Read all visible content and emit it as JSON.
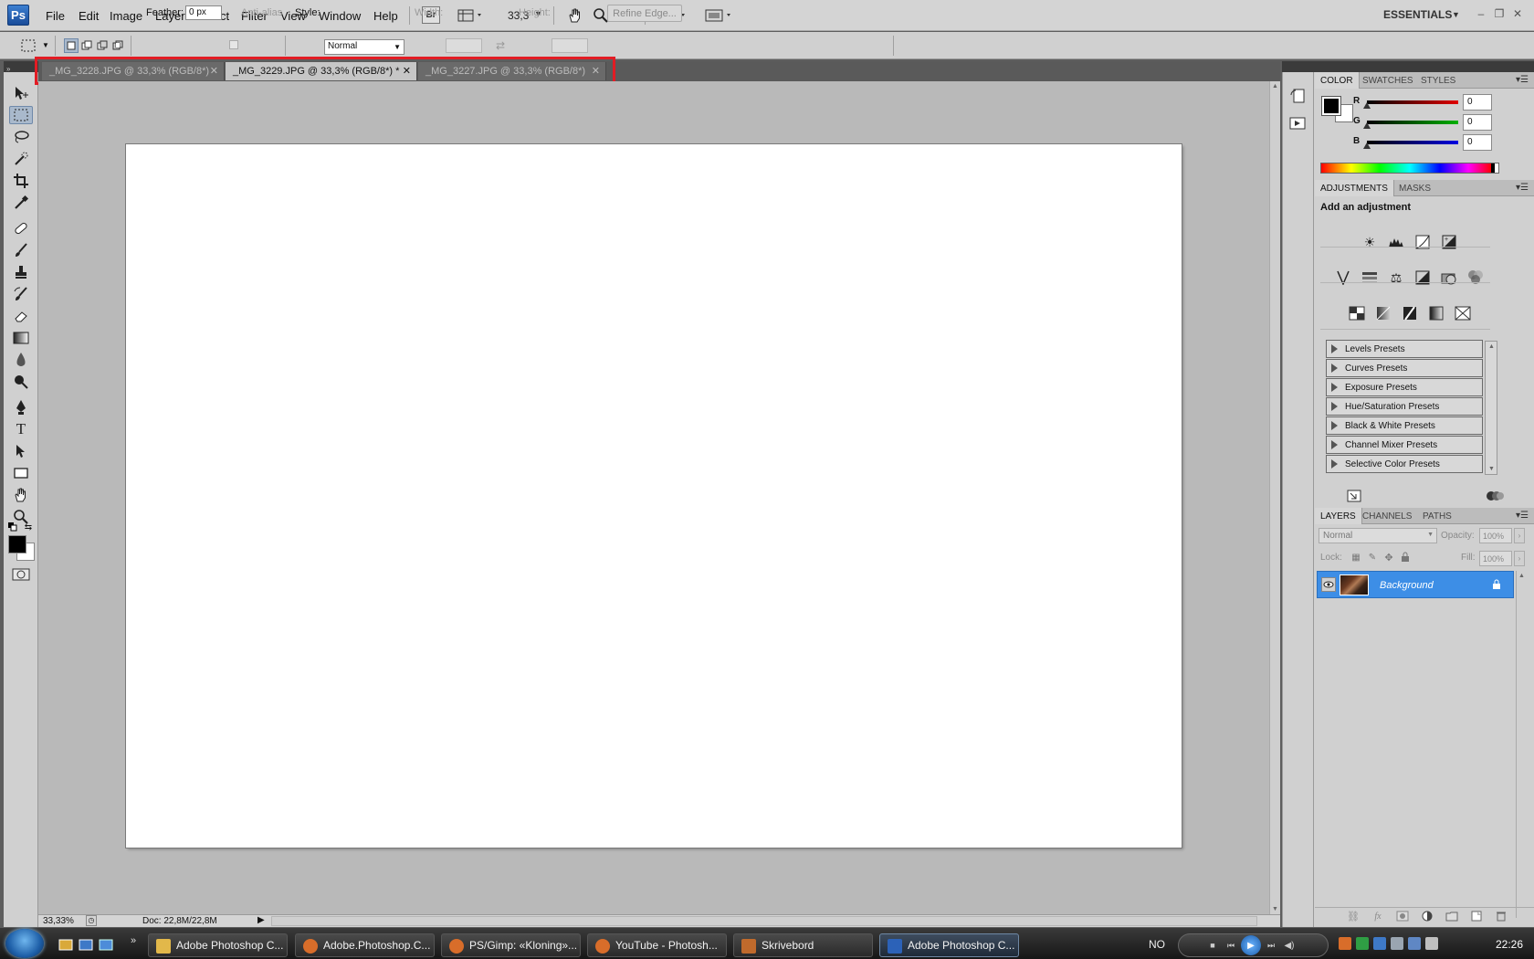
{
  "menubar": {
    "logo": "Ps",
    "items": [
      "File",
      "Edit",
      "Image",
      "Layer",
      "Select",
      "Filter",
      "View",
      "Window",
      "Help"
    ],
    "bridge_label": "Br",
    "zoom_value": "33,3",
    "workspace": "ESSENTIALS"
  },
  "options": {
    "feather_label": "Feather:",
    "feather_value": "0 px",
    "antialias_label": "Anti-alias",
    "style_label": "Style:",
    "style_value": "Normal",
    "width_label": "Width:",
    "height_label": "Height:",
    "refine_label": "Refine Edge..."
  },
  "tabs": [
    {
      "label": "_MG_3228.JPG @ 33,3% (RGB/8*)"
    },
    {
      "label": "_MG_3229.JPG @ 33,3% (RGB/8*) *"
    },
    {
      "label": "_MG_3227.JPG @ 33,3% (RGB/8*)"
    }
  ],
  "status": {
    "zoom": "33,33%",
    "doc": "Doc: 22,8M/22,8M"
  },
  "color_panel": {
    "tabs": [
      "COLOR",
      "SWATCHES",
      "STYLES"
    ],
    "channels": [
      {
        "label": "R",
        "value": "0"
      },
      {
        "label": "G",
        "value": "0"
      },
      {
        "label": "B",
        "value": "0"
      }
    ],
    "foreground": "#000000",
    "background": "#ffffff"
  },
  "adjustments_panel": {
    "tabs": [
      "ADJUSTMENTS",
      "MASKS"
    ],
    "heading": "Add an adjustment",
    "presets": [
      "Levels Presets",
      "Curves Presets",
      "Exposure Presets",
      "Hue/Saturation Presets",
      "Black & White Presets",
      "Channel Mixer Presets",
      "Selective Color Presets"
    ]
  },
  "layers_panel": {
    "tabs": [
      "LAYERS",
      "CHANNELS",
      "PATHS"
    ],
    "blend_mode": "Normal",
    "opacity_label": "Opacity:",
    "opacity_value": "100%",
    "lock_label": "Lock:",
    "fill_label": "Fill:",
    "fill_value": "100%",
    "layers": [
      {
        "name": "Background"
      }
    ]
  },
  "taskbar": {
    "buttons": [
      {
        "label": "Adobe Photoshop C...",
        "icon_color": "#e2b84a"
      },
      {
        "label": "Adobe.Photoshop.C...",
        "icon_color": "#d86d2a"
      },
      {
        "label": "PS/Gimp: «Kloning»...",
        "icon_color": "#d86d2a"
      },
      {
        "label": "YouTube - Photosh...",
        "icon_color": "#d86d2a"
      },
      {
        "label": "Skrivebord",
        "icon_color": "#c06a2c"
      },
      {
        "label": "Adobe Photoshop C...",
        "icon_color": "#2c62b8"
      }
    ],
    "language": "NO",
    "clock": "22:26"
  },
  "colors": {
    "highlight": "#e21c24",
    "selected_layer": "#3d8ee6"
  }
}
